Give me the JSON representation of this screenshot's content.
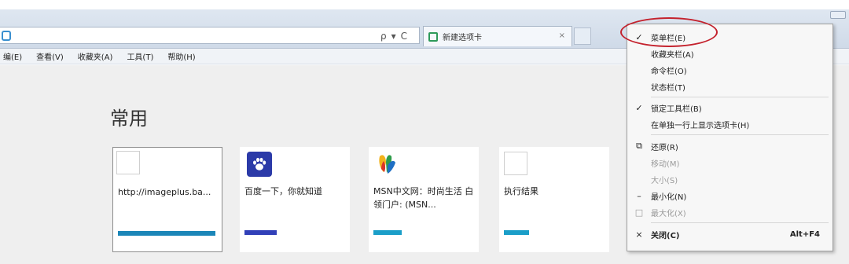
{
  "toolbar": {
    "search_glyph": "ρ",
    "dropdown_glyph": "▾",
    "refresh_glyph": "C"
  },
  "tab": {
    "title": "新建选项卡",
    "close": "×"
  },
  "menubar": {
    "items": [
      "编(E)",
      "查看(V)",
      "收藏夹(A)",
      "工具(T)",
      "帮助(H)"
    ]
  },
  "content": {
    "section_title": "常用",
    "tiles": [
      {
        "label": "http://imageplus.ba...",
        "bar_color": "#1b86b8",
        "bar_width": 0.97
      },
      {
        "label": "百度一下，你就知道",
        "bar_color": "#3140b8",
        "bar_width": 0.32
      },
      {
        "label": "MSN中文网：时尚生活 白领门户: (MSN...",
        "bar_color": "#1b9ec8",
        "bar_width": 0.28
      },
      {
        "label": "执行结果",
        "bar_color": "#1b9ec8",
        "bar_width": 0.25
      }
    ]
  },
  "context_menu": {
    "items": [
      {
        "check": "✓",
        "label": "菜单栏(E)",
        "disabled": false
      },
      {
        "check": "",
        "label": "收藏夹栏(A)",
        "disabled": false
      },
      {
        "check": "",
        "label": "命令栏(O)",
        "disabled": false
      },
      {
        "check": "",
        "label": "状态栏(T)",
        "disabled": false
      },
      {
        "check": "✓",
        "label": "锁定工具栏(B)",
        "disabled": false
      },
      {
        "check": "",
        "label": "在单独一行上显示选项卡(H)",
        "disabled": false
      },
      {
        "check": "⧉",
        "label": "还原(R)",
        "disabled": false
      },
      {
        "check": "",
        "label": "移动(M)",
        "disabled": true
      },
      {
        "check": "",
        "label": "大小(S)",
        "disabled": true
      },
      {
        "check": "–",
        "label": "最小化(N)",
        "disabled": false
      },
      {
        "check": "□",
        "label": "最大化(X)",
        "disabled": true
      },
      {
        "check": "×",
        "label": "关闭(C)",
        "disabled": false,
        "shortcut": "Alt+F4"
      }
    ]
  }
}
